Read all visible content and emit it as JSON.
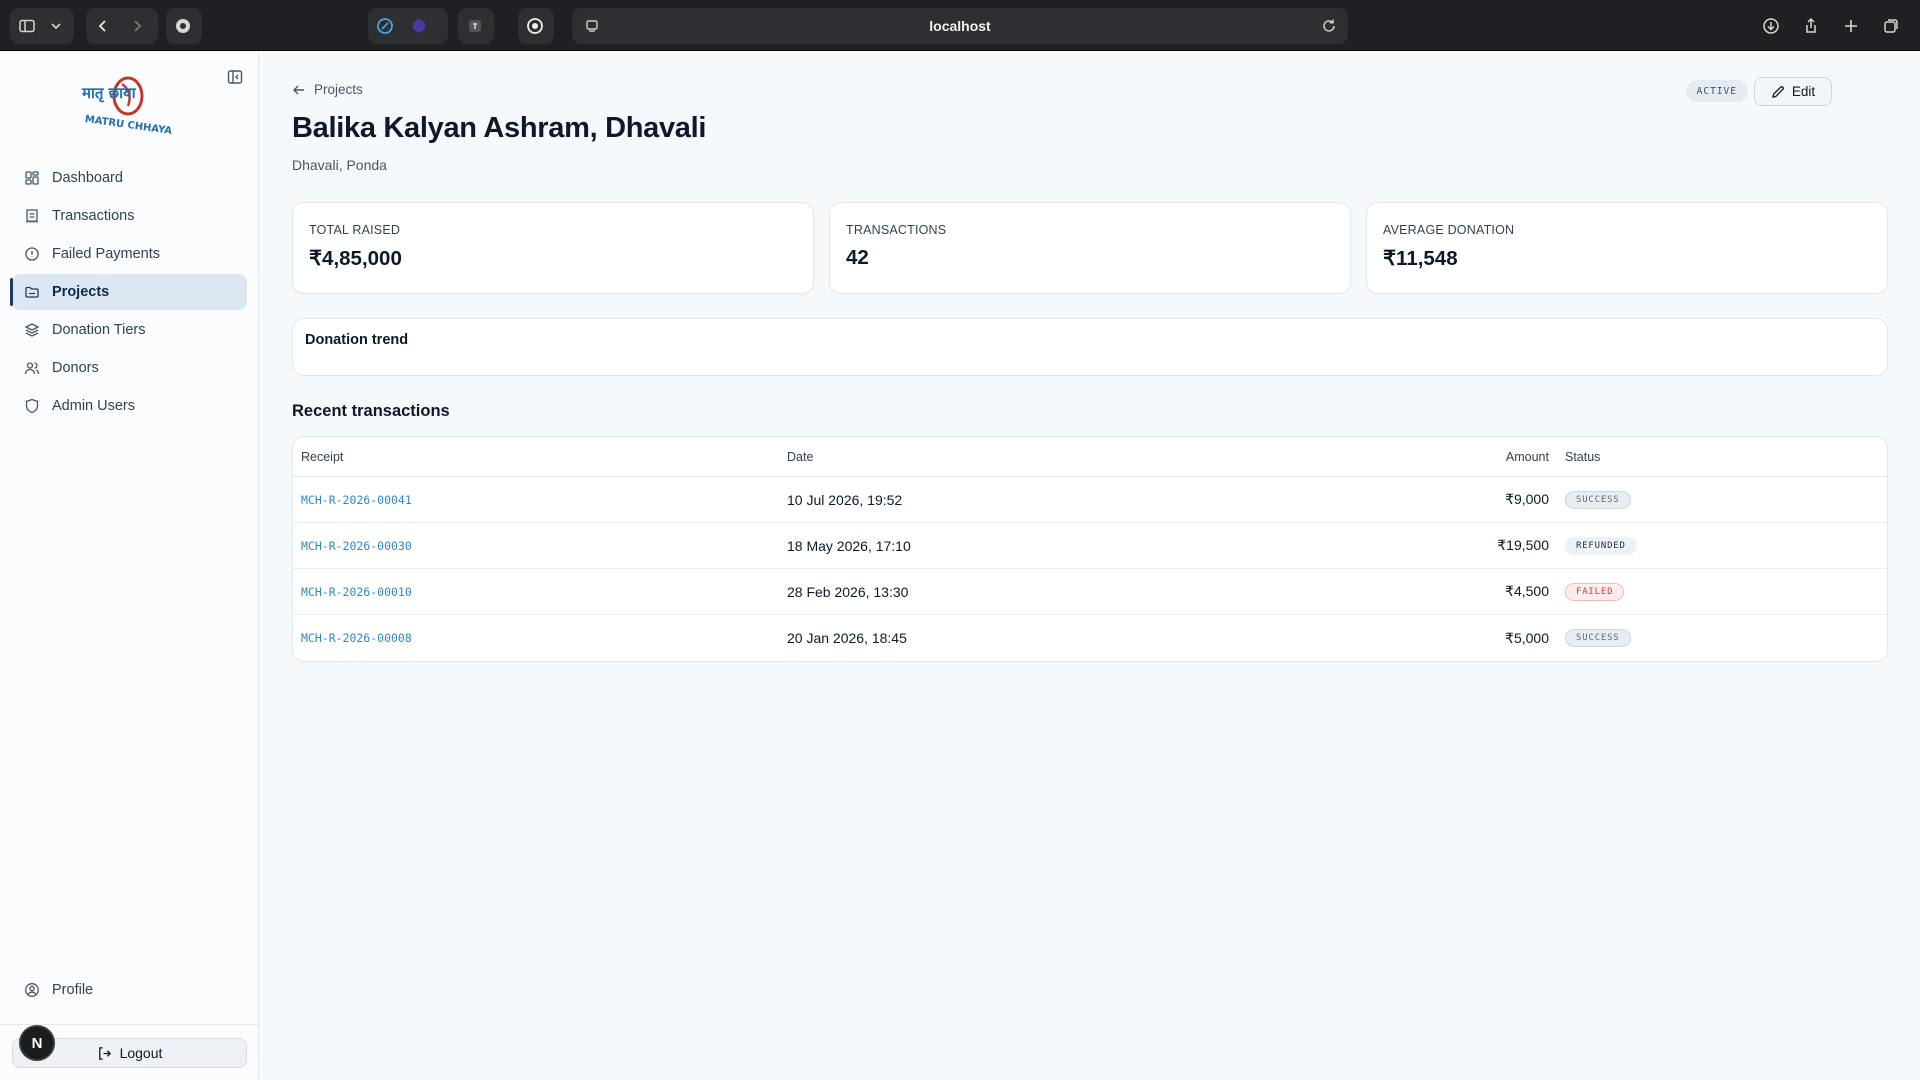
{
  "browser": {
    "url": "localhost"
  },
  "sidebar": {
    "logo_text_top": "मातृ छाया",
    "logo_text_bottom": "MATRU CHHAYA",
    "items": [
      {
        "label": "Dashboard",
        "icon": "dashboard-icon"
      },
      {
        "label": "Transactions",
        "icon": "receipt-icon"
      },
      {
        "label": "Failed Payments",
        "icon": "alert-circle-icon"
      },
      {
        "label": "Projects",
        "icon": "folder-icon",
        "active": true
      },
      {
        "label": "Donation Tiers",
        "icon": "layers-icon"
      },
      {
        "label": "Donors",
        "icon": "users-icon"
      },
      {
        "label": "Admin Users",
        "icon": "shield-icon"
      }
    ],
    "profile_label": "Profile",
    "logout_label": "Logout",
    "avatar_initial": "N"
  },
  "header": {
    "breadcrumb": "Projects",
    "title": "Balika Kalyan Ashram, Dhavali",
    "subtitle": "Dhavali, Ponda",
    "status": "ACTIVE",
    "edit_label": "Edit"
  },
  "stats": [
    {
      "label": "TOTAL RAISED",
      "value": "₹4,85,000"
    },
    {
      "label": "TRANSACTIONS",
      "value": "42"
    },
    {
      "label": "AVERAGE DONATION",
      "value": "₹11,548"
    }
  ],
  "trend": {
    "title": "Donation trend"
  },
  "transactions": {
    "title": "Recent transactions",
    "columns": {
      "receipt": "Receipt",
      "date": "Date",
      "amount": "Amount",
      "status": "Status"
    },
    "rows": [
      {
        "receipt": "MCH-R-2026-00041",
        "date": "10 Jul 2026, 19:52",
        "amount": "₹9,000",
        "status": "SUCCESS"
      },
      {
        "receipt": "MCH-R-2026-00030",
        "date": "18 May 2026, 17:10",
        "amount": "₹19,500",
        "status": "REFUNDED"
      },
      {
        "receipt": "MCH-R-2026-00010",
        "date": "28 Feb 2026, 13:30",
        "amount": "₹4,500",
        "status": "FAILED"
      },
      {
        "receipt": "MCH-R-2026-00008",
        "date": "20 Jan 2026, 18:45",
        "amount": "₹5,000",
        "status": "SUCCESS"
      }
    ]
  },
  "colors": {
    "accent": "#1e3a5f",
    "link": "#2f86c6",
    "failed": "#d23a3a"
  }
}
